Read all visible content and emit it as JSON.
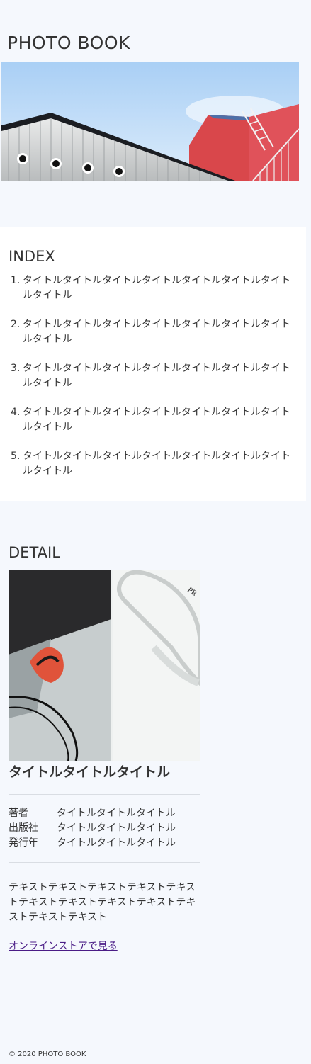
{
  "header": {
    "site_title": "PHOTO BOOK"
  },
  "index": {
    "title": "INDEX",
    "items": [
      {
        "number": "1.",
        "label": "タイトルタイトルタイトルタイトルタイトルタイトルタイトルタイトル"
      },
      {
        "number": "2.",
        "label": "タイトルタイトルタイトルタイトルタイトルタイトルタイトルタイトル"
      },
      {
        "number": "3.",
        "label": "タイトルタイトルタイトルタイトルタイトルタイトルタイトルタイトル"
      },
      {
        "number": "4.",
        "label": "タイトルタイトルタイトルタイトルタイトルタイトルタイトルタイトル"
      },
      {
        "number": "5.",
        "label": "タイトルタイトルタイトルタイトルタイトルタイトルタイトルタイトル"
      }
    ]
  },
  "detail": {
    "title": "DETAIL",
    "book_title": "タイトルタイトルタイトル",
    "meta": [
      {
        "label": "著者",
        "value": "タイトルタイトルタイトル"
      },
      {
        "label": "出版社",
        "value": "タイトルタイトルタイトル"
      },
      {
        "label": "発行年",
        "value": "タイトルタイトルタイトル"
      }
    ],
    "description": "テキストテキストテキストテキストテキストテキストテキストテキストテキストテキストテキストテキスト",
    "store_link": "オンラインストアで見る"
  },
  "footer": {
    "copyright": "© 2020 PHOTO BOOK"
  },
  "colors": {
    "page_background": "#f5f8fd",
    "section_background": "#ffffff",
    "text": "#333333",
    "link": "#4a1c86"
  }
}
